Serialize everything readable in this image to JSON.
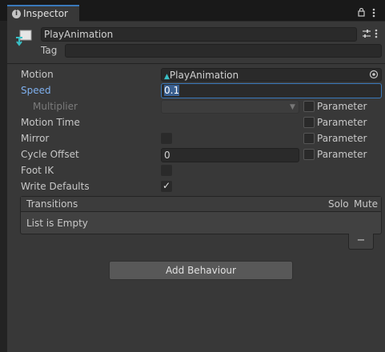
{
  "tab": {
    "title": "Inspector",
    "icon": "info-icon"
  },
  "header": {
    "name": "PlayAnimation",
    "tag_label": "Tag",
    "tag_value": ""
  },
  "fields": {
    "motion": {
      "label": "Motion",
      "value": "PlayAnimation",
      "icon": "animation-clip-icon"
    },
    "speed": {
      "label": "Speed",
      "value": "0.1"
    },
    "multiplier": {
      "label": "Multiplier",
      "value": ""
    },
    "motion_time": {
      "label": "Motion Time"
    },
    "mirror": {
      "label": "Mirror",
      "checked": false
    },
    "cycle_offset": {
      "label": "Cycle Offset",
      "value": "0"
    },
    "foot_ik": {
      "label": "Foot IK",
      "checked": false
    },
    "write_defaults": {
      "label": "Write Defaults",
      "checked": true
    }
  },
  "parameter_label": "Parameter",
  "transitions": {
    "title": "Transitions",
    "solo": "Solo",
    "mute": "Mute",
    "empty": "List is Empty",
    "remove": "−"
  },
  "add_behaviour": "Add Behaviour",
  "colors": {
    "accent": "#3a79bb",
    "speed_label": "#7fb0ee",
    "panel": "#383838",
    "field": "#2a2a2a"
  }
}
